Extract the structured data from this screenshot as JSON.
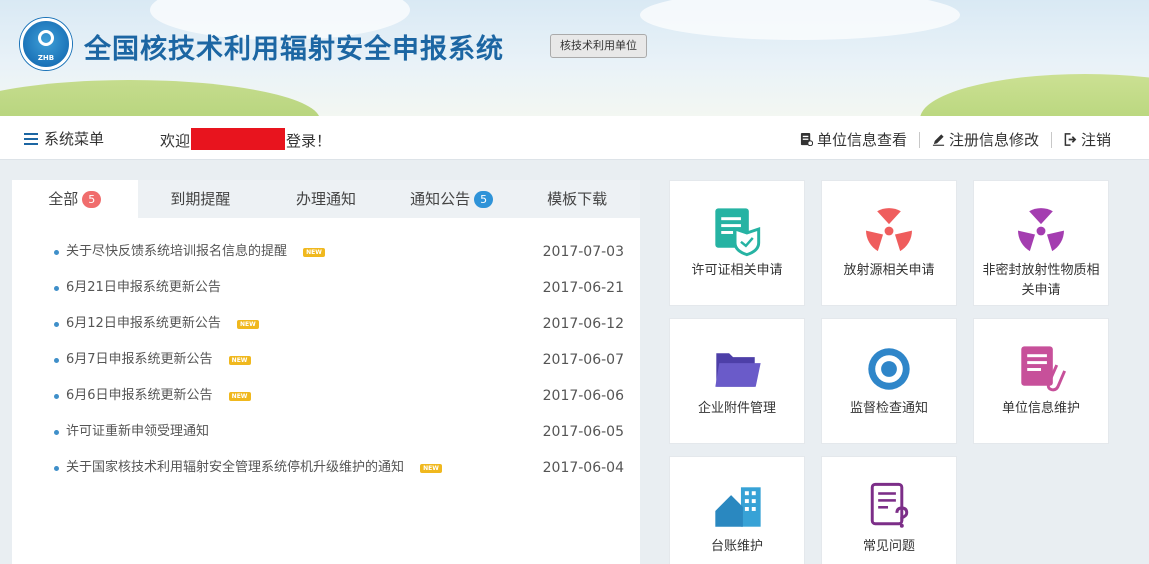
{
  "header": {
    "logo_text": "ZHB",
    "title": "全国核技术利用辐射安全申报系统",
    "role_badge": "核技术利用单位"
  },
  "nav": {
    "menu_label": "系统菜单",
    "welcome_prefix": "欢迎",
    "welcome_suffix": "登录！",
    "links": {
      "unit_info": "单位信息查看",
      "edit_registration": "注册信息修改",
      "logout": "注销"
    }
  },
  "tabs": [
    {
      "label": "全部",
      "badge": "5"
    },
    {
      "label": "到期提醒"
    },
    {
      "label": "办理通知"
    },
    {
      "label": "通知公告",
      "badge": "5"
    },
    {
      "label": "模板下载"
    }
  ],
  "news": [
    {
      "title": "关于尽快反馈系统培训报名信息的提醒",
      "is_new": true,
      "date": "2017-07-03"
    },
    {
      "title": "6月21日申报系统更新公告",
      "is_new": false,
      "date": "2017-06-21"
    },
    {
      "title": "6月12日申报系统更新公告",
      "is_new": true,
      "date": "2017-06-12"
    },
    {
      "title": "6月7日申报系统更新公告",
      "is_new": true,
      "date": "2017-06-07"
    },
    {
      "title": "6月6日申报系统更新公告",
      "is_new": true,
      "date": "2017-06-06"
    },
    {
      "title": "许可证重新申领受理通知",
      "is_new": false,
      "date": "2017-06-05"
    },
    {
      "title": "关于国家核技术利用辐射安全管理系统停机升级维护的通知",
      "is_new": true,
      "date": "2017-06-04"
    }
  ],
  "new_tag": "NEW",
  "tiles": [
    {
      "label": "许可证相关申请",
      "icon": "license-shield-icon"
    },
    {
      "label": "放射源相关申请",
      "icon": "radiation-icon"
    },
    {
      "label": "非密封放射性物质相关申请",
      "icon": "radiation-icon"
    },
    {
      "label": "企业附件管理",
      "icon": "folder-icon"
    },
    {
      "label": "监督检查通知",
      "icon": "eye-icon"
    },
    {
      "label": "单位信息维护",
      "icon": "document-clip-icon"
    },
    {
      "label": "台账维护",
      "icon": "ledger-icon"
    },
    {
      "label": "常见问题",
      "icon": "question-doc-icon"
    }
  ],
  "colors": {
    "brand_blue": "#1c66a3",
    "teal": "#26b3a3",
    "radiation_red": "#ef5d5d",
    "purple": "#a43db0",
    "folder_purple": "#6a5bc9",
    "eye_blue": "#2f86c9",
    "doc_pink": "#c7509a",
    "ledger_blue": "#37a2d6",
    "faq_purple": "#7c2e88",
    "badge_red": "#f06d6d",
    "badge_blue": "#2f93d8"
  }
}
